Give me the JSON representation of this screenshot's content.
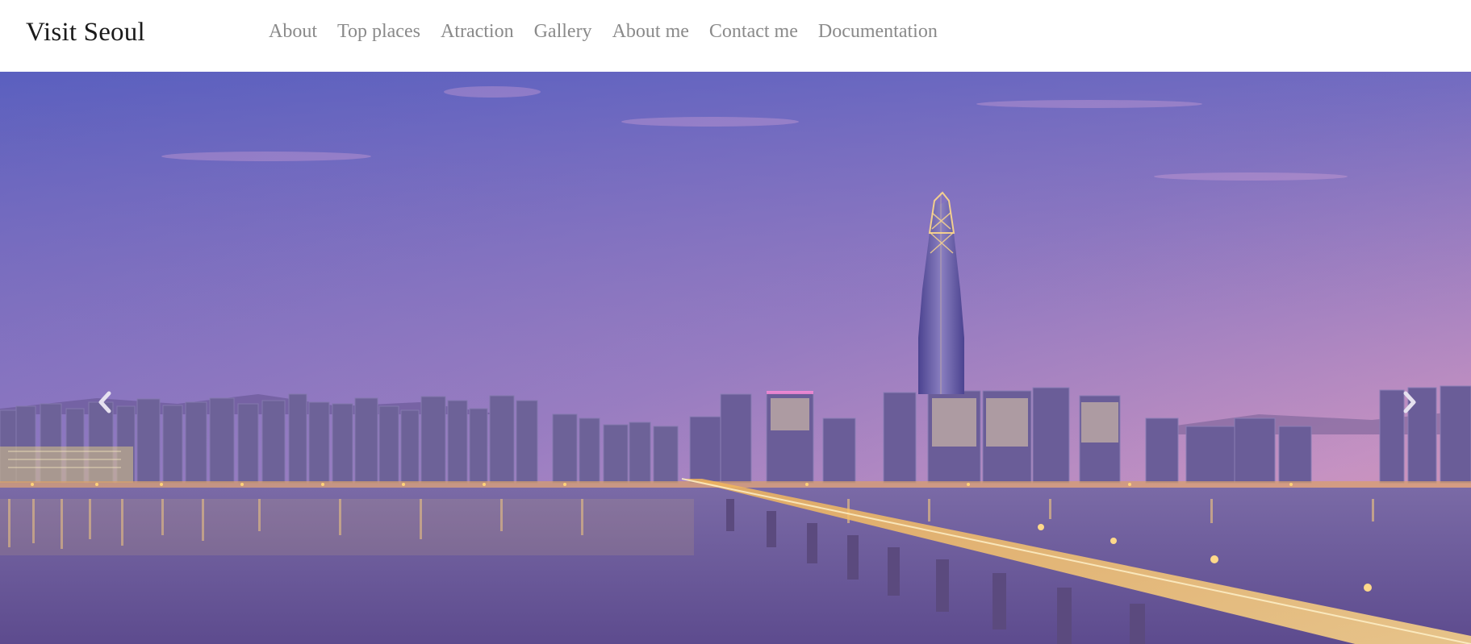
{
  "header": {
    "brand": "Visit Seoul",
    "nav_items": [
      "About",
      "Top places",
      "Atraction",
      "Gallery",
      "About me",
      "Contact me",
      "Documentation"
    ]
  },
  "carousel": {
    "prev_icon": "chevron-left-icon",
    "next_icon": "chevron-right-icon"
  },
  "colors": {
    "sky_top": "#5f63c2",
    "sky_bottom": "#d08fb6",
    "water": "#6e5a9a",
    "lights": "#ffc96a"
  }
}
